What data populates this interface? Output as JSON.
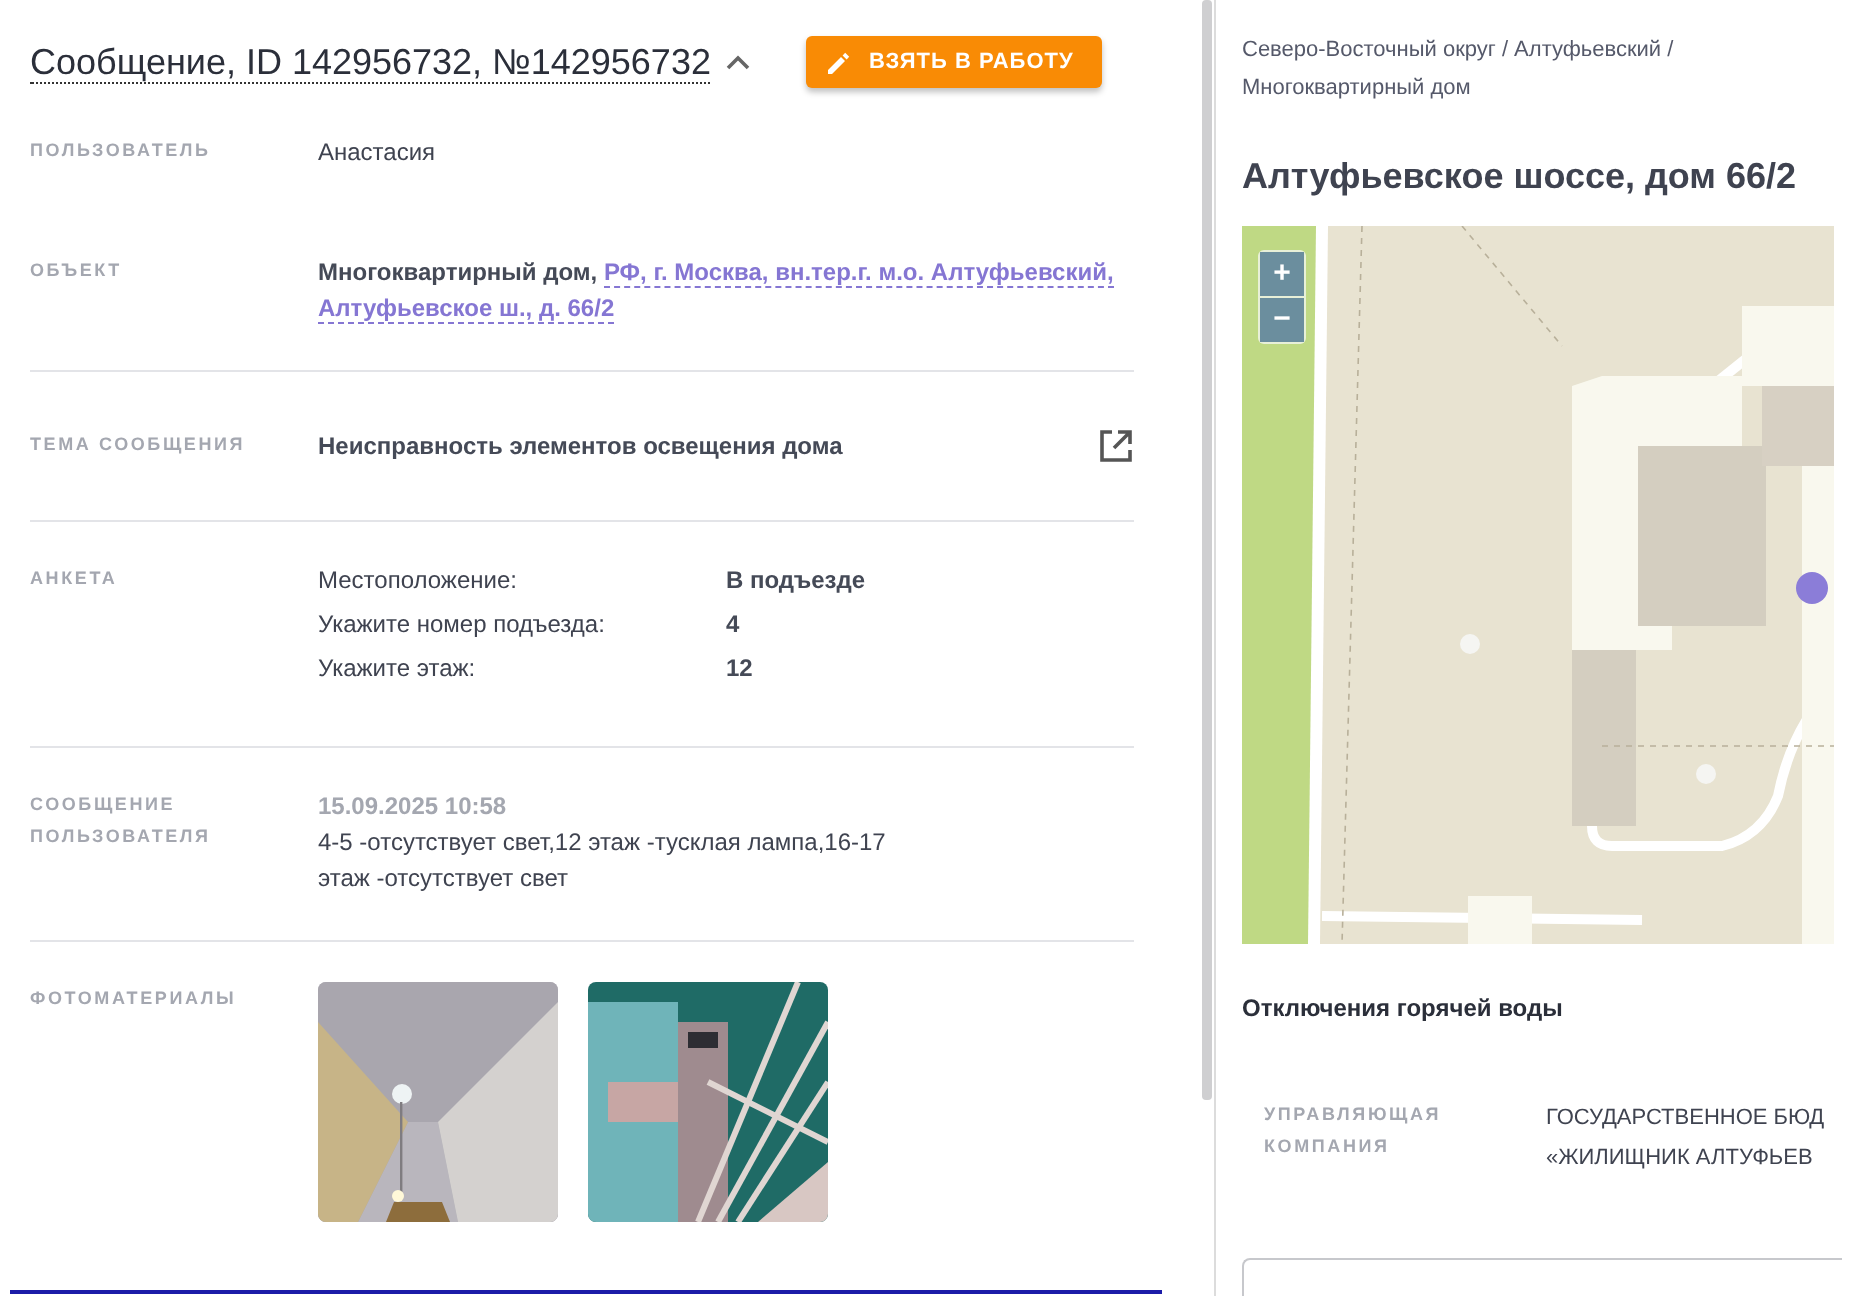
{
  "message": {
    "title": "Сообщение, ID 142956732, №142956732",
    "expanded": true,
    "action_button": "ВЗЯТЬ В РАБОТУ",
    "fields": [
      {
        "kind": "text",
        "label": "ПОЛЬЗОВАТЕЛЬ",
        "value": "Анастасия"
      },
      {
        "kind": "object",
        "label": "ОБЪЕКТ",
        "object_type": "Многоквартирный дом,",
        "address_lines": [
          "РФ, г. Москва, вн.тер.г. м.о. Алтуфьевский,",
          "Алтуфьевское ш., д. 66/2"
        ]
      },
      {
        "kind": "topic",
        "label": "ТЕМА СООБЩЕНИЯ",
        "value": "Неисправность элементов освещения дома"
      },
      {
        "kind": "survey",
        "label": "АНКЕТА",
        "answers": [
          {
            "question": "Местоположение:",
            "answer": "В подъезде"
          },
          {
            "question": "Укажите номер подъезда:",
            "answer": "4"
          },
          {
            "question": "Укажите этаж:",
            "answer": "12"
          }
        ]
      },
      {
        "kind": "message",
        "label": "СООБЩЕНИЕ ПОЛЬЗОВАТЕЛЯ",
        "time": "15.09.2025 10:58",
        "text": "4-5 -отсутствует свет,12 этаж -тусклая лампа,16-17 этаж -отсутствует свет"
      },
      {
        "kind": "photos",
        "label": "ФОТОМАТЕРИАЛЫ"
      }
    ]
  },
  "location": {
    "breadcrumb": "Северо-Восточный округ / Алтуфьевский / Многоквартирный дом",
    "title": "Алтуфьевское шоссе, дом 66/2",
    "map": {
      "kind": "picture",
      "zoom_in": "+",
      "zoom_out": "−"
    },
    "hot_water": "Отключения горячей воды",
    "company": {
      "label": "УПРАВЛЯЮЩАЯ КОМПАНИЯ",
      "value_lines": [
        "ГОСУДАРСТВЕННОЕ БЮД",
        "«ЖИЛИЩНИК АЛТУФЬЕВ"
      ]
    }
  }
}
